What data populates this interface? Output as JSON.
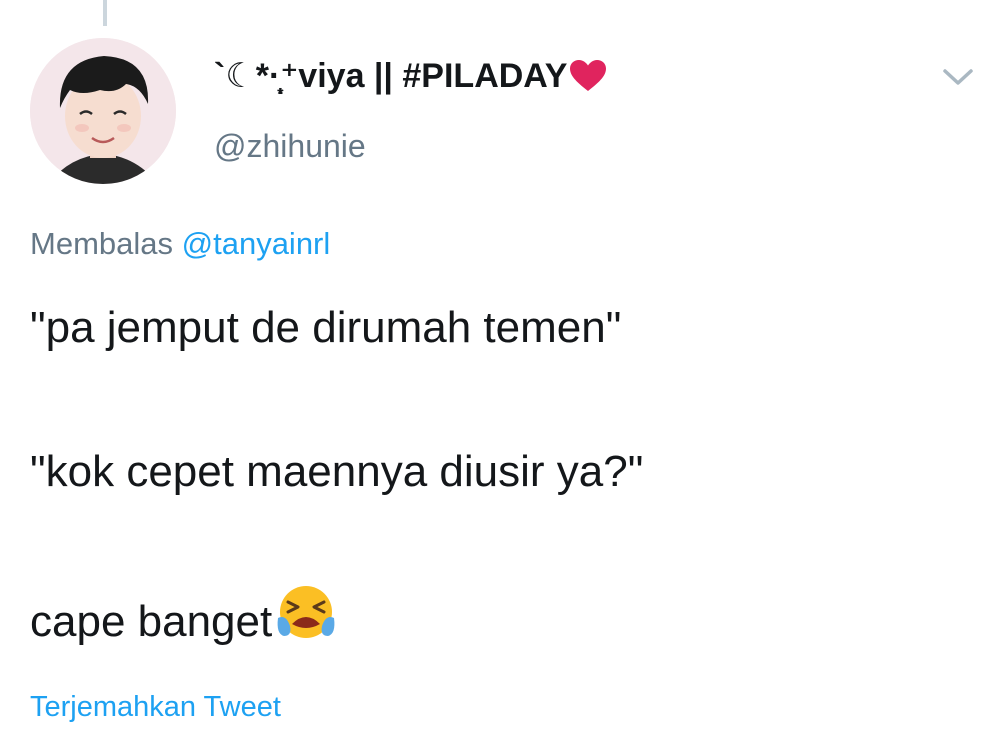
{
  "tweet": {
    "author": {
      "display_name": "`☾*·̩͙⁺viya || #PILADAY",
      "handle": "@zhihunie",
      "name_icon": "pink-heart-icon",
      "avatar_icon": "profile-photo"
    },
    "more_icon": "chevron-down-icon",
    "reply": {
      "prefix": "Membalas",
      "mention": "@tanyainrl"
    },
    "text_lines": [
      "\"pa jemput de dirumah temen\"",
      "\"kok cepet maennya diusir ya?\"",
      "cape banget"
    ],
    "trailing_emoji": "loudly-crying-face-icon",
    "translate_label": "Terjemahkan Tweet"
  },
  "colors": {
    "text": "#14171a",
    "secondary": "#657786",
    "link": "#1da1f2",
    "heart": "#e0245e"
  }
}
